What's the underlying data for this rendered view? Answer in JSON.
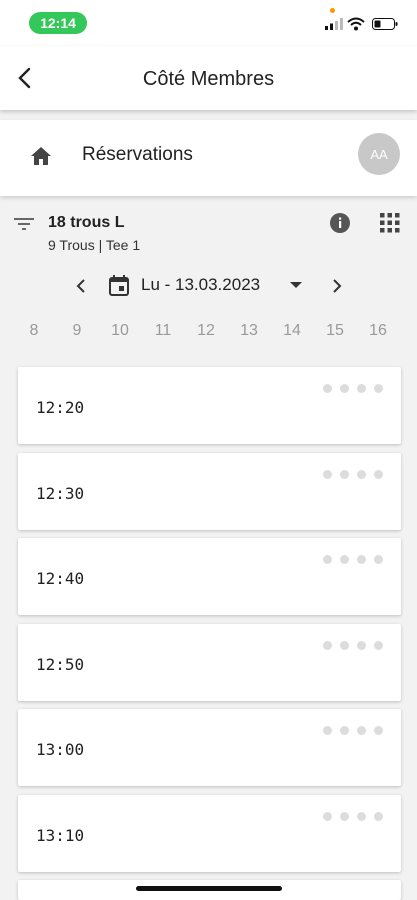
{
  "status_bar": {
    "time": "12:14"
  },
  "header": {
    "title": "Côté Membres"
  },
  "section": {
    "title": "Réservations",
    "avatar_initials": "AA"
  },
  "course": {
    "name": "18 trous L",
    "details": "9 Trous | Tee 1"
  },
  "date": {
    "label": "Lu - 13.03.2023"
  },
  "hours": [
    "8",
    "9",
    "10",
    "11",
    "12",
    "13",
    "14",
    "15",
    "16"
  ],
  "slots": [
    {
      "time": "12:20"
    },
    {
      "time": "12:30"
    },
    {
      "time": "12:40"
    },
    {
      "time": "12:50"
    },
    {
      "time": "13:00"
    },
    {
      "time": "13:10"
    }
  ],
  "colors": {
    "status_pill": "#34c759",
    "background": "#f2f2f2",
    "avatar": "#c8c8c8"
  }
}
